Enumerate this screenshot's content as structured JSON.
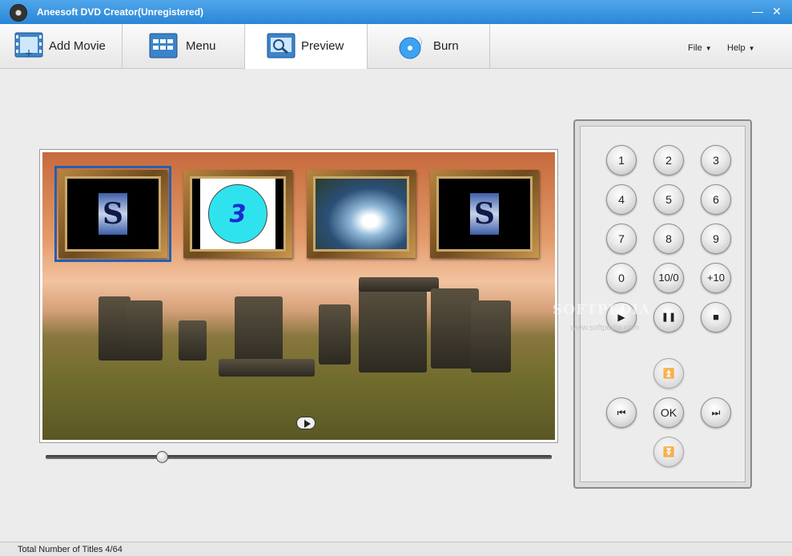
{
  "window": {
    "title": "Aneesoft DVD Creator(Unregistered)",
    "min_glyph": "—",
    "close_glyph": "✕"
  },
  "toolbar": {
    "add_movie": "Add Movie",
    "menu": "Menu",
    "preview": "Preview",
    "burn": "Burn",
    "active": "Preview"
  },
  "menus": {
    "file": "File",
    "help": "Help",
    "caret": "▼"
  },
  "preview": {
    "thumbnails": [
      {
        "kind": "logo",
        "glyph": "S",
        "selected": true
      },
      {
        "kind": "clock",
        "glyph": "3",
        "selected": false
      },
      {
        "kind": "video",
        "glyph": "",
        "selected": false
      },
      {
        "kind": "logo",
        "glyph": "S",
        "selected": false
      }
    ],
    "slider_position": 0.23
  },
  "remote": {
    "keys": [
      "1",
      "2",
      "3",
      "4",
      "5",
      "6",
      "7",
      "8",
      "9",
      "0",
      "10/0",
      "+10"
    ],
    "play": "▶",
    "pause": "❚❚",
    "stop": "■",
    "up": "⏫",
    "prev": "⏮",
    "ok": "OK",
    "next": "⏭",
    "down": "⏬"
  },
  "watermark": {
    "main": "SOFTPEDIA",
    "sub": "www.softpedia.com"
  },
  "status": {
    "text": "Total Number of Titles 4/64"
  },
  "colors": {
    "titlebar": "#2a86d6",
    "selection": "#2360b0",
    "clock": "#2fe3ee"
  }
}
